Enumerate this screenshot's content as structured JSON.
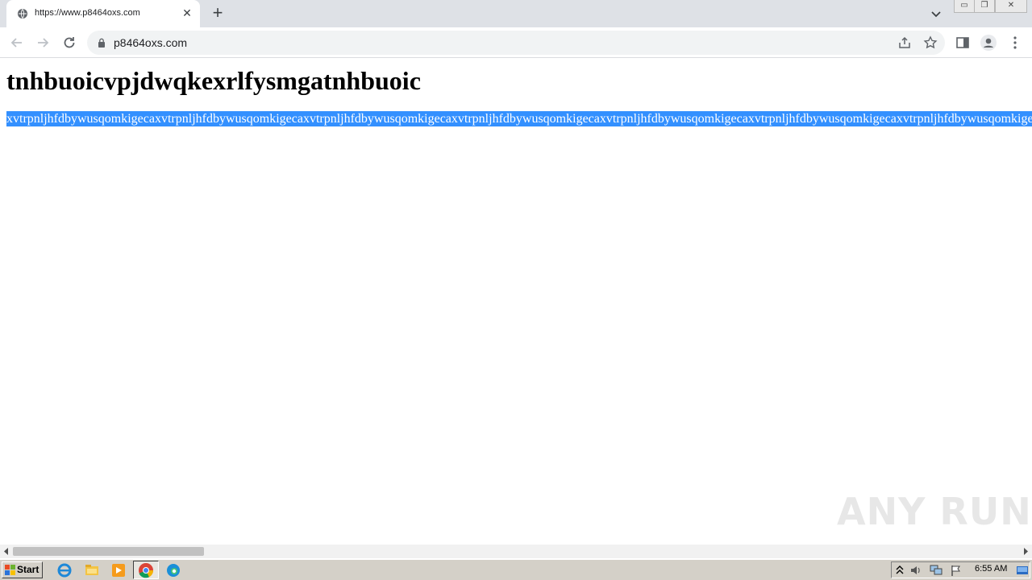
{
  "browser": {
    "tab_title": "https://www.p8464oxs.com",
    "tab_close": "✕",
    "new_tab": "+",
    "url": "p8464oxs.com"
  },
  "page": {
    "heading": "tnhbuoicvpjdwqkexrlfysmgatnhbuoic",
    "selected_text": "xvtrpnljhfdbywusqomkigecaxvtrpnljhfdbywusqomkigecaxvtrpnljhfdbywusqomkigecaxvtrpnljhfdbywusqomkigecaxvtrpnljhfdbywusqomkigecaxvtrpnljhfdbywusqomkigecaxvtrpnljhfdbywusqomkigecaxvtrpnljhfdbywusqomkigecaxvtrpnljhfdbywusqomkigecaxvtrpnljhfdbywusqomkigecaxvtrpnljhfdbywusqomkigecaxvtrpnljhfdbyw"
  },
  "watermark": "ANY RUN",
  "taskbar": {
    "start_label": "Start",
    "clock": "6:55 AM"
  },
  "colors": {
    "selection": "#3390ff",
    "tabstrip": "#dee1e6",
    "taskbar": "#d4d0c8"
  }
}
